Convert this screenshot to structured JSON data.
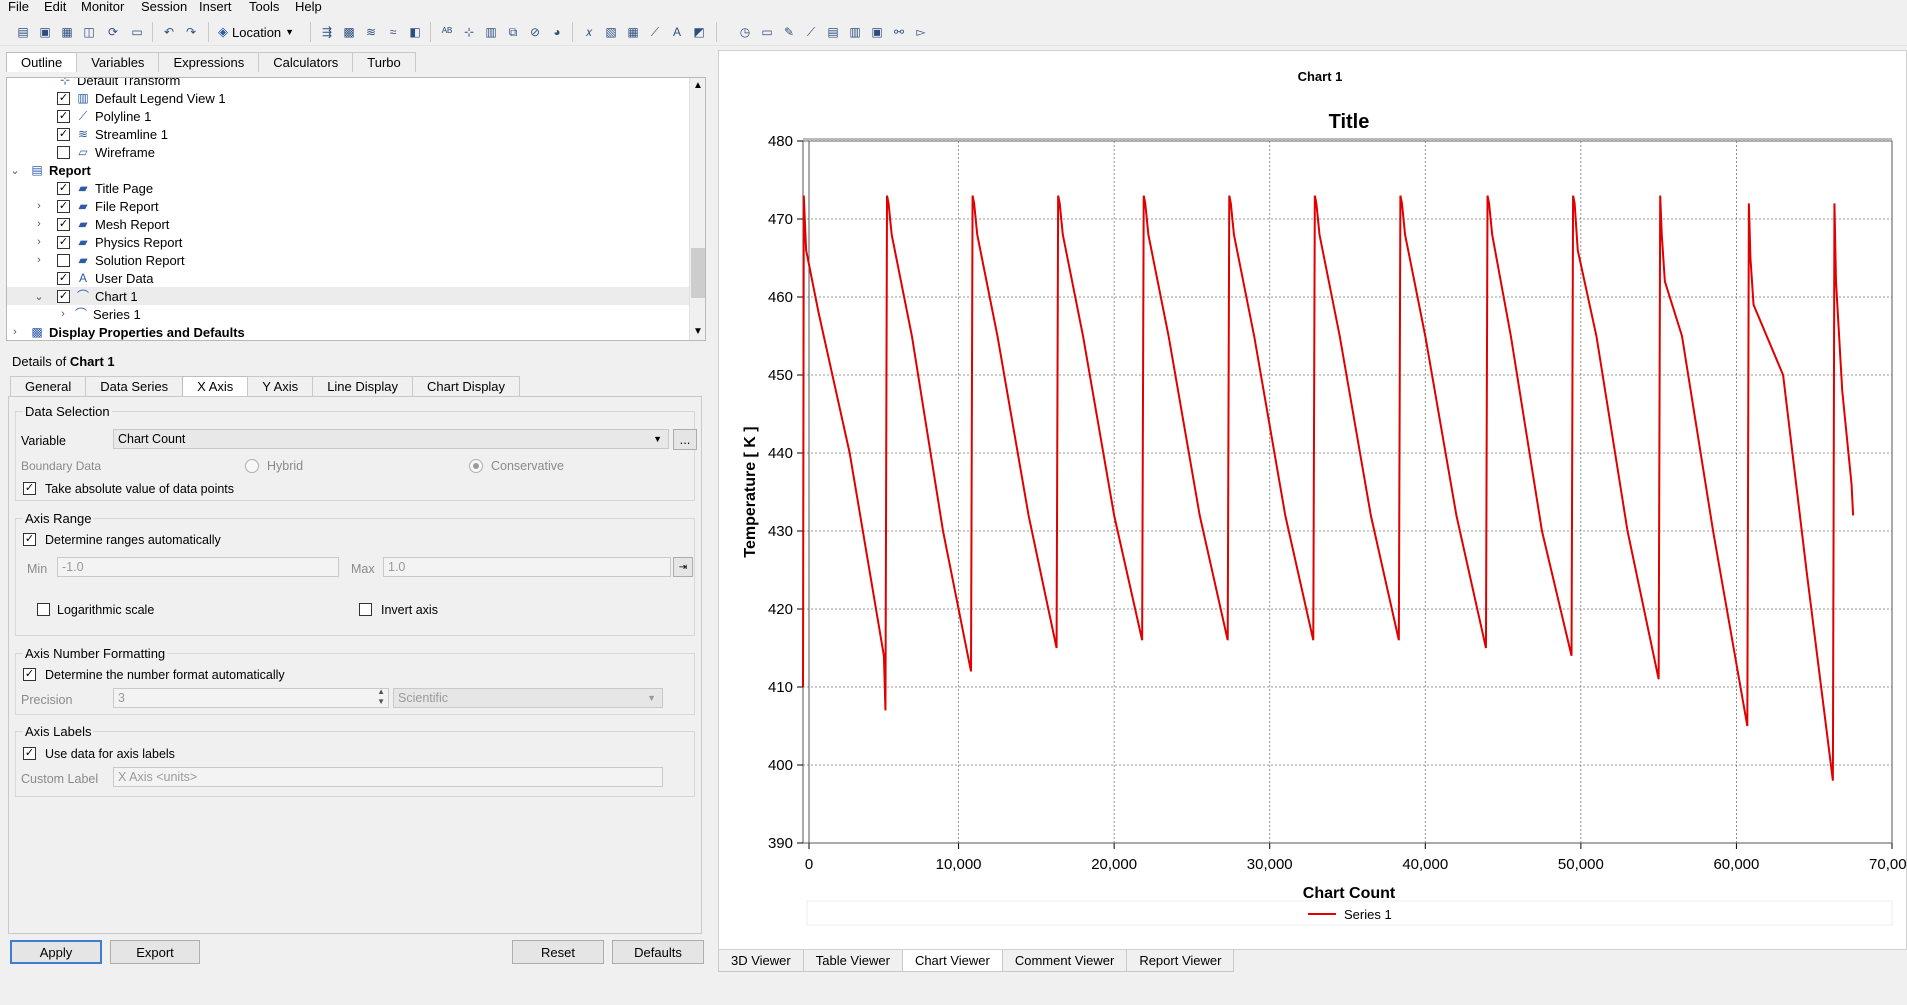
{
  "menu": [
    "File",
    "Edit",
    "Monitor",
    "Session",
    "Insert",
    "Tools",
    "Help"
  ],
  "toolbar": {
    "location_label": "Location"
  },
  "top_tabs": [
    "Outline",
    "Variables",
    "Expressions",
    "Calculators",
    "Turbo"
  ],
  "tree": [
    {
      "label": "Default Transform",
      "checked": null,
      "icon": "transform-icon",
      "level": 2,
      "expander": ""
    },
    {
      "label": "Default Legend View 1",
      "checked": true,
      "icon": "legend-icon",
      "level": 2,
      "expander": ""
    },
    {
      "label": "Polyline 1",
      "checked": true,
      "icon": "polyline-icon",
      "level": 2,
      "expander": ""
    },
    {
      "label": "Streamline 1",
      "checked": true,
      "icon": "streamline-icon",
      "level": 2,
      "expander": ""
    },
    {
      "label": "Wireframe",
      "checked": false,
      "icon": "wireframe-icon",
      "level": 2,
      "expander": ""
    },
    {
      "label": "Report",
      "checked": null,
      "icon": "report-icon",
      "level": 0,
      "expander": "v",
      "bold": true
    },
    {
      "label": "Title Page",
      "checked": true,
      "icon": "page-icon",
      "level": 2,
      "expander": ""
    },
    {
      "label": "File Report",
      "checked": true,
      "icon": "page-icon",
      "level": 2,
      "expander": ">"
    },
    {
      "label": "Mesh Report",
      "checked": true,
      "icon": "page-icon",
      "level": 2,
      "expander": ">"
    },
    {
      "label": "Physics Report",
      "checked": true,
      "icon": "page-icon",
      "level": 2,
      "expander": ">"
    },
    {
      "label": "Solution Report",
      "checked": false,
      "icon": "page-icon",
      "level": 2,
      "expander": ">"
    },
    {
      "label": "User Data",
      "checked": true,
      "icon": "user-data-icon",
      "level": 2,
      "expander": ""
    },
    {
      "label": "Chart 1",
      "checked": true,
      "icon": "chart-icon",
      "level": 2,
      "expander": "v",
      "selected": true
    },
    {
      "label": "Series 1",
      "checked": null,
      "icon": "series-icon",
      "level": 3,
      "expander": ">"
    },
    {
      "label": "Display Properties and Defaults",
      "checked": null,
      "icon": "display-icon",
      "level": 0,
      "expander": ">",
      "bold": true
    }
  ],
  "details": {
    "prefix": "Details of",
    "object": "Chart 1",
    "tabs": [
      "General",
      "Data Series",
      "X Axis",
      "Y Axis",
      "Line Display",
      "Chart Display"
    ],
    "active_tab": "X Axis",
    "data_selection": {
      "title": "Data Selection",
      "variable_label": "Variable",
      "variable_value": "Chart Count",
      "more_button": "...",
      "boundary_label": "Boundary Data",
      "hybrid": "Hybrid",
      "conservative": "Conservative",
      "absolute_label": "Take absolute value of data points",
      "absolute_checked": true
    },
    "axis_range": {
      "title": "Axis Range",
      "auto_label": "Determine ranges automatically",
      "auto_checked": true,
      "min_label": "Min",
      "min_value": "-1.0",
      "max_label": "Max",
      "max_value": "1.0",
      "log_label": "Logarithmic scale",
      "log_checked": false,
      "invert_label": "Invert axis",
      "invert_checked": false
    },
    "number_format": {
      "title": "Axis Number Formatting",
      "auto_label": "Determine the number format automatically",
      "auto_checked": true,
      "precision_label": "Precision",
      "precision_value": "3",
      "format_value": "Scientific"
    },
    "axis_labels": {
      "title": "Axis Labels",
      "use_data_label": "Use data for axis labels",
      "use_data_checked": true,
      "custom_label": "Custom Label",
      "custom_placeholder": "X Axis <units>"
    }
  },
  "buttons": {
    "apply": "Apply",
    "export": "Export",
    "reset": "Reset",
    "defaults": "Defaults"
  },
  "viewer_tabs": [
    "3D Viewer",
    "Table Viewer",
    "Chart Viewer",
    "Comment Viewer",
    "Report Viewer"
  ],
  "active_viewer": "Chart Viewer",
  "colors": {
    "series": "#e00000",
    "accent": "#2f5aa8"
  },
  "chart_data": {
    "type": "line",
    "header": "Chart 1",
    "title": "Title",
    "xlabel": "Chart Count",
    "ylabel": "Temperature [ K ]",
    "xlim": [
      0,
      70000
    ],
    "ylim": [
      390,
      480
    ],
    "xticks": [
      "0",
      "10,000",
      "20,000",
      "30,000",
      "40,000",
      "50,000",
      "60,000",
      "70,000"
    ],
    "yticks": [
      "390",
      "400",
      "410",
      "420",
      "430",
      "440",
      "450",
      "460",
      "470",
      "480"
    ],
    "grid": true,
    "legend": "bottom",
    "series": [
      {
        "name": "Series 1",
        "x": [
          0,
          50,
          200,
          1000,
          3000,
          5200,
          5300,
          5400,
          5500,
          5700,
          7000,
          9000,
          10800,
          10900,
          11000,
          11200,
          12500,
          14500,
          16300,
          16400,
          16500,
          16700,
          18000,
          20000,
          21800,
          21900,
          22000,
          22200,
          23500,
          25500,
          27300,
          27400,
          27500,
          27700,
          29000,
          31000,
          32800,
          32900,
          33000,
          33200,
          34500,
          36500,
          38300,
          38400,
          38500,
          38700,
          40000,
          42000,
          43900,
          44000,
          44100,
          44300,
          45500,
          47500,
          49400,
          49500,
          49600,
          49800,
          51000,
          53000,
          55000,
          55100,
          55200,
          55400,
          56500,
          58500,
          60700,
          60800,
          60900,
          61100,
          63000,
          64500,
          66200,
          66300,
          66400,
          66600,
          66800,
          67000,
          67200,
          67400,
          67500
        ],
        "y": [
          410,
          473,
          466,
          458,
          440,
          414,
          407,
          473,
          472,
          468,
          455,
          430,
          412,
          473,
          472,
          468,
          455,
          432,
          415,
          473,
          472,
          468,
          455,
          432,
          416,
          473,
          472,
          468,
          455,
          432,
          416,
          473,
          472,
          468,
          455,
          432,
          416,
          473,
          472,
          468,
          455,
          432,
          416,
          473,
          472,
          468,
          455,
          432,
          415,
          473,
          472,
          468,
          455,
          430,
          414,
          473,
          472,
          466,
          455,
          430,
          411,
          473,
          468,
          462,
          455,
          430,
          405,
          472,
          465,
          459,
          450,
          425,
          398,
          472,
          462,
          455,
          448,
          444,
          440,
          436,
          432
        ]
      }
    ]
  }
}
